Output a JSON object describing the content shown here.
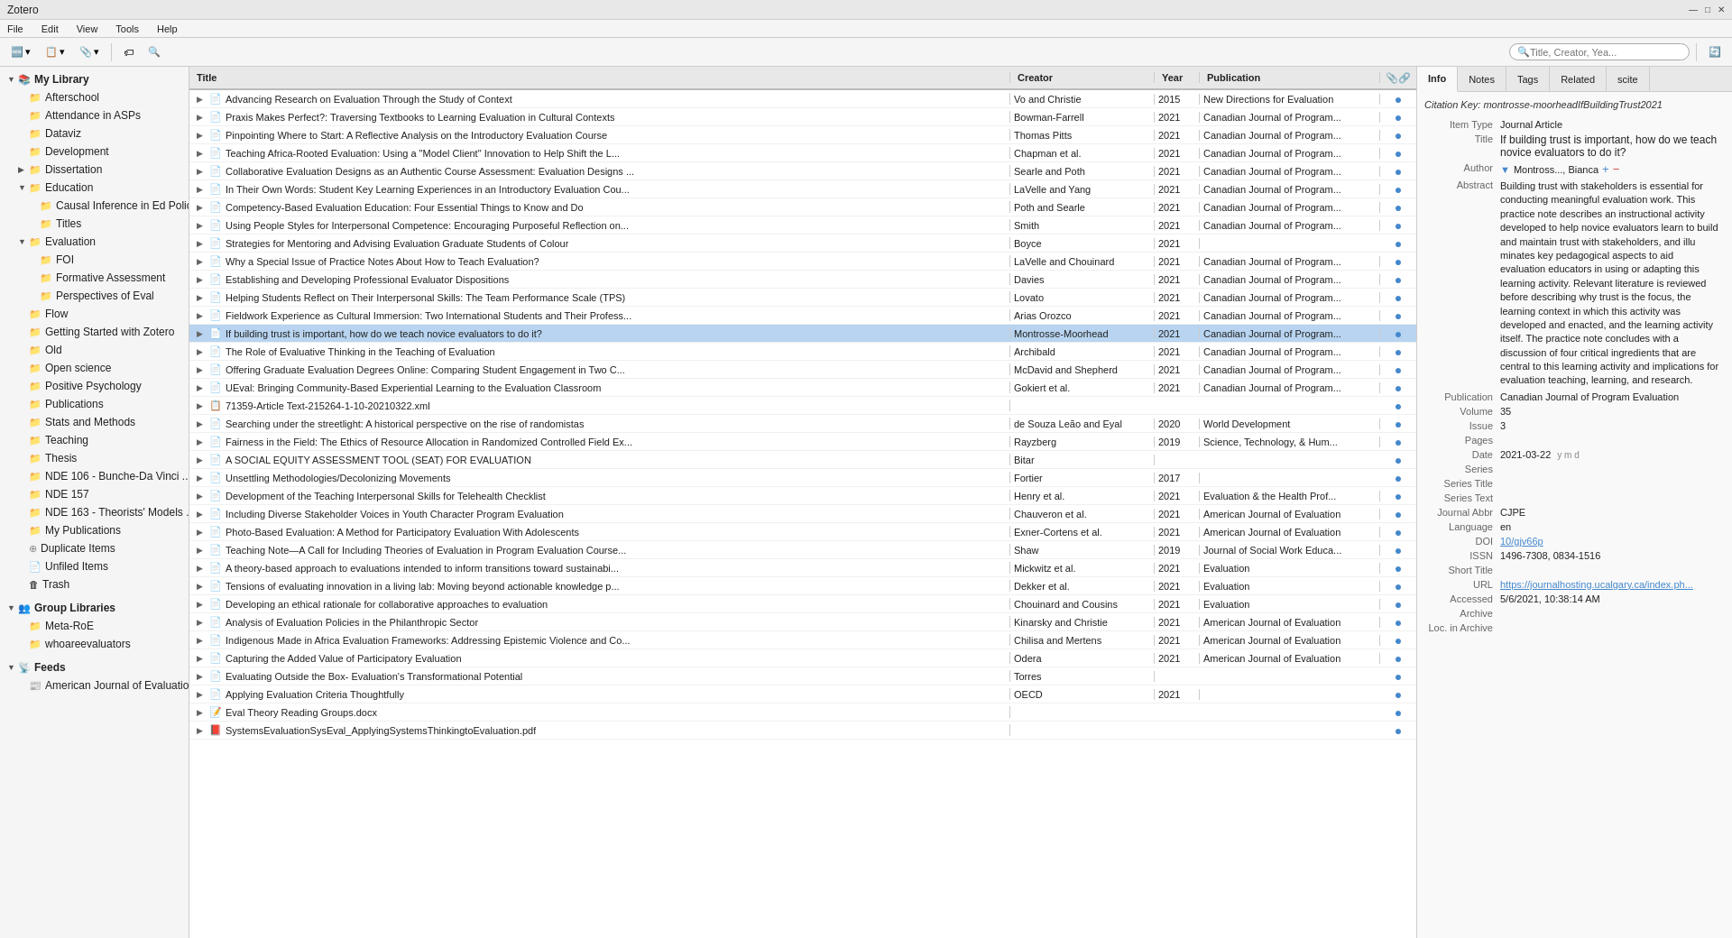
{
  "app": {
    "title": "Zotero",
    "win_controls": [
      "—",
      "□",
      "✕"
    ]
  },
  "menubar": {
    "items": [
      "File",
      "Edit",
      "View",
      "Tools",
      "Help"
    ]
  },
  "toolbar": {
    "new_item": "🆕",
    "new_note": "📋",
    "attach": "📎",
    "tag": "🏷",
    "search_placeholder": "Title, Creator, Yea..."
  },
  "sidebar": {
    "my_library": "My Library",
    "items": [
      {
        "label": "Afterschool",
        "indent": 1,
        "icon": "📁",
        "arrow": ""
      },
      {
        "label": "Attendance in ASPs",
        "indent": 1,
        "icon": "📁",
        "arrow": ""
      },
      {
        "label": "Dataviz",
        "indent": 1,
        "icon": "📁",
        "arrow": ""
      },
      {
        "label": "Development",
        "indent": 1,
        "icon": "📁",
        "arrow": ""
      },
      {
        "label": "Dissertation",
        "indent": 1,
        "icon": "📁",
        "arrow": "▶"
      },
      {
        "label": "Education",
        "indent": 1,
        "icon": "📁",
        "arrow": "▼"
      },
      {
        "label": "Causal Inference in Ed Polic...",
        "indent": 2,
        "icon": "📁",
        "arrow": ""
      },
      {
        "label": "Titles",
        "indent": 2,
        "icon": "📁",
        "arrow": ""
      },
      {
        "label": "Evaluation",
        "indent": 1,
        "icon": "📁",
        "arrow": "▼"
      },
      {
        "label": "FOI",
        "indent": 2,
        "icon": "📁",
        "arrow": ""
      },
      {
        "label": "Formative Assessment",
        "indent": 2,
        "icon": "📁",
        "arrow": ""
      },
      {
        "label": "Perspectives of Eval",
        "indent": 2,
        "icon": "📁",
        "arrow": ""
      },
      {
        "label": "Flow",
        "indent": 1,
        "icon": "📁",
        "arrow": ""
      },
      {
        "label": "Getting Started with Zotero",
        "indent": 1,
        "icon": "📁",
        "arrow": ""
      },
      {
        "label": "Old",
        "indent": 1,
        "icon": "📁",
        "arrow": ""
      },
      {
        "label": "Open science",
        "indent": 1,
        "icon": "📁",
        "arrow": ""
      },
      {
        "label": "Positive Psychology",
        "indent": 1,
        "icon": "📁",
        "arrow": ""
      },
      {
        "label": "Publications",
        "indent": 1,
        "icon": "📁",
        "arrow": ""
      },
      {
        "label": "Stats and Methods",
        "indent": 1,
        "icon": "📁",
        "arrow": ""
      },
      {
        "label": "Teaching",
        "indent": 1,
        "icon": "📁",
        "arrow": ""
      },
      {
        "label": "Thesis",
        "indent": 1,
        "icon": "📁",
        "arrow": ""
      },
      {
        "label": "NDE 106 - Bunche-Da Vinci ...",
        "indent": 1,
        "icon": "📁",
        "arrow": ""
      },
      {
        "label": "NDE 157",
        "indent": 1,
        "icon": "📁",
        "arrow": ""
      },
      {
        "label": "NDE 163 - Theorists' Models ...",
        "indent": 1,
        "icon": "📁",
        "arrow": ""
      },
      {
        "label": "My Publications",
        "indent": 1,
        "icon": "📁",
        "arrow": ""
      },
      {
        "label": "Duplicate Items",
        "indent": 1,
        "icon": "🔁",
        "arrow": ""
      },
      {
        "label": "Unfiled Items",
        "indent": 1,
        "icon": "📄",
        "arrow": ""
      },
      {
        "label": "Trash",
        "indent": 1,
        "icon": "🗑",
        "arrow": ""
      }
    ],
    "group_libraries": "Group Libraries",
    "groups": [
      {
        "label": "Meta-RoE",
        "indent": 1,
        "icon": "📁",
        "arrow": ""
      },
      {
        "label": "whoareevaluators",
        "indent": 1,
        "icon": "📁",
        "arrow": ""
      }
    ],
    "feeds": "Feeds",
    "feed_items": [
      {
        "label": "American Journal of Evaluation",
        "indent": 1,
        "icon": "📰",
        "arrow": ""
      }
    ]
  },
  "table": {
    "columns": [
      "Title",
      "Creator",
      "Year",
      "Publication"
    ],
    "rows": [
      {
        "title": "Advancing Research on Evaluation Through the Study of Context",
        "creator": "Vo and Christie",
        "year": "2015",
        "pub": "New Directions for Evaluation",
        "icon": "📄",
        "selected": false
      },
      {
        "title": "Praxis Makes Perfect?: Traversing Textbooks to Learning Evaluation in Cultural Contexts",
        "creator": "Bowman-Farrell",
        "year": "2021",
        "pub": "Canadian Journal of Program...",
        "icon": "📄",
        "selected": false
      },
      {
        "title": "Pinpointing Where to Start: A Reflective Analysis on the Introductory Evaluation Course",
        "creator": "Thomas Pitts",
        "year": "2021",
        "pub": "Canadian Journal of Program...",
        "icon": "📄",
        "selected": false
      },
      {
        "title": "Teaching Africa-Rooted Evaluation: Using a \"Model Client\" Innovation to Help Shift the L...",
        "creator": "Chapman et al.",
        "year": "2021",
        "pub": "Canadian Journal of Program...",
        "icon": "📄",
        "selected": false
      },
      {
        "title": "Collaborative Evaluation Designs as an Authentic Course Assessment: Evaluation Designs ...",
        "creator": "Searle and Poth",
        "year": "2021",
        "pub": "Canadian Journal of Program...",
        "icon": "📄",
        "selected": false
      },
      {
        "title": "In Their Own Words: Student Key Learning Experiences in an Introductory Evaluation Cou...",
        "creator": "LaVelle and Yang",
        "year": "2021",
        "pub": "Canadian Journal of Program...",
        "icon": "📄",
        "selected": false
      },
      {
        "title": "Competency-Based Evaluation Education: Four Essential Things to Know and Do",
        "creator": "Poth and Searle",
        "year": "2021",
        "pub": "Canadian Journal of Program...",
        "icon": "📄",
        "selected": false
      },
      {
        "title": "Using People Styles for Interpersonal Competence: Encouraging Purposeful Reflection on...",
        "creator": "Smith",
        "year": "2021",
        "pub": "Canadian Journal of Program...",
        "icon": "📄",
        "selected": false
      },
      {
        "title": "Strategies for Mentoring and Advising Evaluation Graduate Students of Colour",
        "creator": "Boyce",
        "year": "2021",
        "pub": "",
        "icon": "📄",
        "selected": false
      },
      {
        "title": "Why a Special Issue of Practice Notes About How to Teach Evaluation?",
        "creator": "LaVelle and Chouinard",
        "year": "2021",
        "pub": "Canadian Journal of Program...",
        "icon": "📄",
        "selected": false
      },
      {
        "title": "Establishing and Developing Professional Evaluator Dispositions",
        "creator": "Davies",
        "year": "2021",
        "pub": "Canadian Journal of Program...",
        "icon": "📄",
        "selected": false
      },
      {
        "title": "Helping Students Reflect on Their Interpersonal Skills: The Team Performance Scale (TPS)",
        "creator": "Lovato",
        "year": "2021",
        "pub": "Canadian Journal of Program...",
        "icon": "📄",
        "selected": false
      },
      {
        "title": "Fieldwork Experience as Cultural Immersion: Two International Students and Their Profess...",
        "creator": "Arias Orozco",
        "year": "2021",
        "pub": "Canadian Journal of Program...",
        "icon": "📄",
        "selected": false
      },
      {
        "title": "If building trust is important, how do we teach novice evaluators to do it?",
        "creator": "Montrosse-Moorhead",
        "year": "2021",
        "pub": "Canadian Journal of Program...",
        "icon": "📄",
        "selected": true
      },
      {
        "title": "The Role of Evaluative Thinking in the Teaching of Evaluation",
        "creator": "Archibald",
        "year": "2021",
        "pub": "Canadian Journal of Program...",
        "icon": "📄",
        "selected": false
      },
      {
        "title": "Offering Graduate Evaluation Degrees Online: Comparing Student Engagement in Two C...",
        "creator": "McDavid and Shepherd",
        "year": "2021",
        "pub": "Canadian Journal of Program...",
        "icon": "📄",
        "selected": false
      },
      {
        "title": "UEval: Bringing Community-Based Experiential Learning to the Evaluation Classroom",
        "creator": "Gokiert et al.",
        "year": "2021",
        "pub": "Canadian Journal of Program...",
        "icon": "📄",
        "selected": false
      },
      {
        "title": "71359-Article Text-215264-1-10-20210322.xml",
        "creator": "",
        "year": "",
        "pub": "",
        "icon": "📋",
        "selected": false
      },
      {
        "title": "Searching under the streetlight: A historical perspective on the rise of randomistas",
        "creator": "de Souza Leão and Eyal",
        "year": "2020",
        "pub": "World Development",
        "icon": "📄",
        "selected": false
      },
      {
        "title": "Fairness in the Field: The Ethics of Resource Allocation in Randomized Controlled Field Ex...",
        "creator": "Rayzberg",
        "year": "2019",
        "pub": "Science, Technology, & Hum...",
        "icon": "📄",
        "selected": false
      },
      {
        "title": "A SOCIAL EQUITY ASSESSMENT TOOL (SEAT) FOR EVALUATION",
        "creator": "Bitar",
        "year": "",
        "pub": "",
        "icon": "📄",
        "selected": false
      },
      {
        "title": "Unsettling Methodologies/Decolonizing Movements",
        "creator": "Fortier",
        "year": "2017",
        "pub": "",
        "icon": "📄",
        "selected": false
      },
      {
        "title": "Development of the Teaching Interpersonal Skills for Telehealth Checklist",
        "creator": "Henry et al.",
        "year": "2021",
        "pub": "Evaluation & the Health Prof...",
        "icon": "📄",
        "selected": false
      },
      {
        "title": "Including Diverse Stakeholder Voices in Youth Character Program Evaluation",
        "creator": "Chauveron et al.",
        "year": "2021",
        "pub": "American Journal of Evaluation",
        "icon": "📄",
        "selected": false
      },
      {
        "title": "Photo-Based Evaluation: A Method for Participatory Evaluation With Adolescents",
        "creator": "Exner-Cortens et al.",
        "year": "2021",
        "pub": "American Journal of Evaluation",
        "icon": "📄",
        "selected": false
      },
      {
        "title": "Teaching Note—A Call for Including Theories of Evaluation in Program Evaluation Course...",
        "creator": "Shaw",
        "year": "2019",
        "pub": "Journal of Social Work Educa...",
        "icon": "📄",
        "selected": false
      },
      {
        "title": "A theory-based approach to evaluations intended to inform transitions toward sustainabi...",
        "creator": "Mickwitz et al.",
        "year": "2021",
        "pub": "Evaluation",
        "icon": "📄",
        "selected": false
      },
      {
        "title": "Tensions of evaluating innovation in a living lab: Moving beyond actionable knowledge p...",
        "creator": "Dekker et al.",
        "year": "2021",
        "pub": "Evaluation",
        "icon": "📄",
        "selected": false
      },
      {
        "title": "Developing an ethical rationale for collaborative approaches to evaluation",
        "creator": "Chouinard and Cousins",
        "year": "2021",
        "pub": "Evaluation",
        "icon": "📄",
        "selected": false
      },
      {
        "title": "Analysis of Evaluation Policies in the Philanthropic Sector",
        "creator": "Kinarsky and Christie",
        "year": "2021",
        "pub": "American Journal of Evaluation",
        "icon": "📄",
        "selected": false
      },
      {
        "title": "Indigenous Made in Africa Evaluation Frameworks: Addressing Epistemic Violence and Co...",
        "creator": "Chilisa and Mertens",
        "year": "2021",
        "pub": "American Journal of Evaluation",
        "icon": "📄",
        "selected": false
      },
      {
        "title": "Capturing the Added Value of Participatory Evaluation",
        "creator": "Odera",
        "year": "2021",
        "pub": "American Journal of Evaluation",
        "icon": "📄",
        "selected": false
      },
      {
        "title": "Evaluating Outside the Box- Evaluation's Transformational Potential",
        "creator": "Torres",
        "year": "",
        "pub": "",
        "icon": "📄",
        "selected": false
      },
      {
        "title": "Applying Evaluation Criteria Thoughtfully",
        "creator": "OECD",
        "year": "2021",
        "pub": "",
        "icon": "📄",
        "selected": false
      },
      {
        "title": "Eval Theory Reading Groups.docx",
        "creator": "",
        "year": "",
        "pub": "",
        "icon": "📝",
        "selected": false
      },
      {
        "title": "SystemsEvaluationSysEval_ApplyingSystemsThinkingtoEvaluation.pdf",
        "creator": "",
        "year": "",
        "pub": "",
        "icon": "📕",
        "selected": false
      }
    ]
  },
  "right_panel": {
    "tabs": [
      "Info",
      "Notes",
      "Tags",
      "Related",
      "scite"
    ],
    "active_tab": "Info",
    "cite_key": "Citation Key: montrosse-moorheadIfBuildingTrust2021",
    "fields": {
      "item_type_label": "Item Type",
      "item_type_value": "Journal Article",
      "title_label": "Title",
      "title_value": "If building trust is important, how do we teach novice evaluators to do it?",
      "author_label": "Author",
      "author_value": "Montross..., Bianca",
      "abstract_label": "Abstract",
      "abstract_value": "Building trust with stakeholders is essential for conducting meaningful evaluation work. This practice note describes an instructional activity developed to help novice evaluators learn to build and maintain trust with stakeholders, and illu minates key pedagogical aspects to aid evaluation educators in using or adapting this learning activity. Relevant literature is reviewed before describing why trust is the focus, the learning context in which this activity was developed and enacted, and the learning activity itself. The practice note concludes with a discussion of four critical ingredients that are central to this learning activity and implications for evaluation teaching, learning, and research.",
      "publication_label": "Publication",
      "publication_value": "Canadian Journal of Program Evaluation",
      "volume_label": "Volume",
      "volume_value": "35",
      "issue_label": "Issue",
      "issue_value": "3",
      "pages_label": "Pages",
      "pages_value": "",
      "date_label": "Date",
      "date_value": "2021-03-22",
      "series_label": "Series",
      "series_value": "",
      "series_title_label": "Series Title",
      "series_title_value": "",
      "series_text_label": "Series Text",
      "series_text_value": "",
      "journal_abbr_label": "Journal Abbr",
      "journal_abbr_value": "CJPE",
      "language_label": "Language",
      "language_value": "en",
      "doi_label": "DOI",
      "doi_value": "10/gjv66p",
      "issn_label": "ISSN",
      "issn_value": "1496-7308, 0834-1516",
      "short_title_label": "Short Title",
      "short_title_value": "",
      "url_label": "URL",
      "url_value": "https://journalhosting.ucalgary.ca/index.ph...",
      "accessed_label": "Accessed",
      "accessed_value": "5/6/2021, 10:38:14 AM",
      "archive_label": "Archive",
      "archive_value": "",
      "loc_in_archive_label": "Loc. in Archive",
      "loc_in_archive_value": ""
    }
  }
}
